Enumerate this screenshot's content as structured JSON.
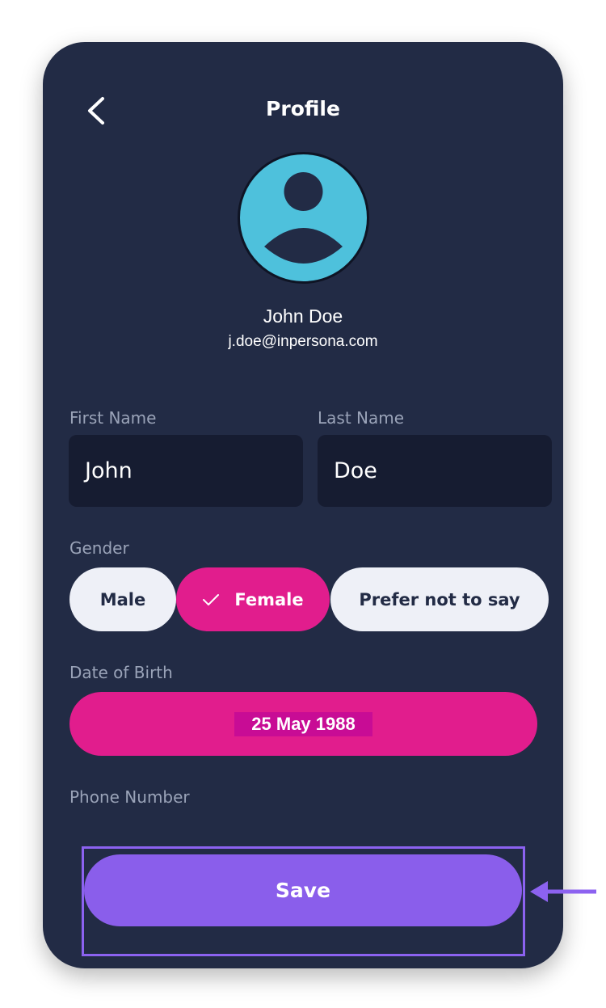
{
  "header": {
    "title": "Profile",
    "back_icon": "chevron-left-icon"
  },
  "profile": {
    "name": "John Doe",
    "email": "j.doe@inpersona.com",
    "avatar_icon": "user-avatar-icon"
  },
  "form": {
    "first_name": {
      "label": "First Name",
      "value": "John"
    },
    "last_name": {
      "label": "Last Name",
      "value": "Doe"
    },
    "gender": {
      "label": "Gender",
      "options": [
        "Male",
        "Female",
        "Prefer not to say"
      ],
      "selected": "Female"
    },
    "dob": {
      "label": "Date of Birth",
      "value": "25 May 1988"
    },
    "phone": {
      "label": "Phone Number"
    }
  },
  "actions": {
    "save_label": "Save"
  },
  "colors": {
    "background": "#222b45",
    "field": "#161c31",
    "accent_pink": "#e11d8d",
    "accent_purple": "#8a5eeb",
    "avatar": "#4ec1dc",
    "pill_light": "#eef0f7"
  }
}
